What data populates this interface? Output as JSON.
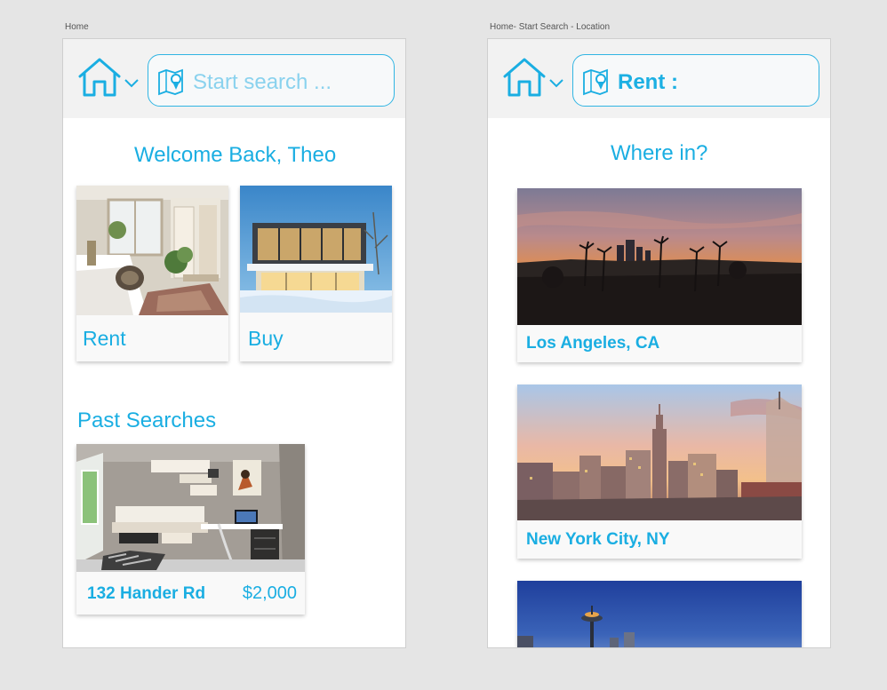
{
  "artboards": {
    "home": {
      "label": "Home",
      "search_placeholder": "Start search ...",
      "welcome": "Welcome Back, Theo",
      "categories": [
        {
          "label": "Rent",
          "image": "bedroom-interior-photo"
        },
        {
          "label": "Buy",
          "image": "modern-house-exterior-photo"
        }
      ],
      "past_searches_title": "Past Searches",
      "past_searches": [
        {
          "address": "132 Hander Rd",
          "price": "$2,000",
          "image": "bedroom-office-photo"
        }
      ]
    },
    "location": {
      "label": "Home- Start Search - Location",
      "search_value": "Rent :",
      "prompt": "Where in?",
      "cities": [
        {
          "name": "Los Angeles, CA",
          "image": "los-angeles-skyline-sunset-photo"
        },
        {
          "name": "New York City, NY",
          "image": "new-york-skyline-sunset-photo"
        },
        {
          "name": "",
          "image": "seattle-skyline-photo"
        }
      ]
    }
  },
  "icons": {
    "home": "house-icon",
    "dropdown": "chevron-down-icon",
    "search": "map-pin-icon"
  },
  "colors": {
    "accent": "#1aaee2",
    "header_bg": "#f2f2f2",
    "canvas_bg": "#e5e5e5"
  }
}
